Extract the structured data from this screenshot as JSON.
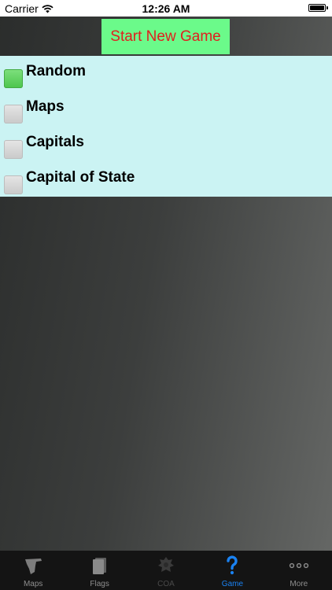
{
  "status_bar": {
    "carrier": "Carrier",
    "time": "12:26 AM"
  },
  "start_button": {
    "label": "Start New Game",
    "background": "#6bfa8a",
    "text_color": "#e0201e"
  },
  "options": [
    {
      "label": "Random",
      "checked": true
    },
    {
      "label": "Maps",
      "checked": false
    },
    {
      "label": "Capitals",
      "checked": false
    },
    {
      "label": "Capital of State",
      "checked": false
    }
  ],
  "tab_bar": {
    "tabs": [
      {
        "label": "Maps",
        "icon": "map-icon",
        "state": "normal"
      },
      {
        "label": "Flags",
        "icon": "flags-icon",
        "state": "normal"
      },
      {
        "label": "COA",
        "icon": "coat-of-arms-icon",
        "state": "disabled"
      },
      {
        "label": "Game",
        "icon": "question-mark-icon",
        "state": "active"
      },
      {
        "label": "More",
        "icon": "more-dots-icon",
        "state": "normal"
      }
    ],
    "active_color": "#1a82f2"
  }
}
